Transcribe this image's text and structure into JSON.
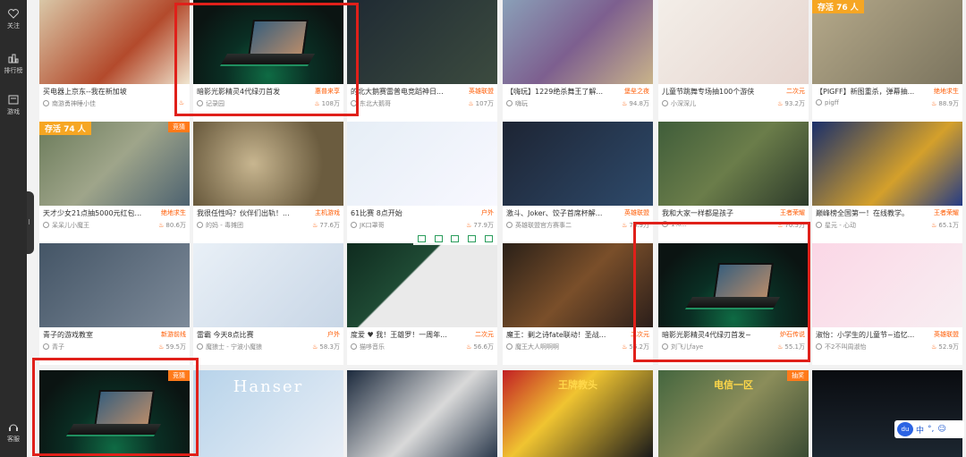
{
  "sidebar": {
    "items": [
      {
        "label": "关注",
        "icon": "heart-icon"
      },
      {
        "label": "排行榜",
        "icon": "bar-chart-icon"
      },
      {
        "label": "游戏",
        "icon": "gamepad-icon"
      },
      {
        "label": "客服",
        "icon": "headset-icon"
      }
    ]
  },
  "rows": [
    [
      {
        "title": "买电器上京东--我在新加坡",
        "category": "",
        "streamer": "南游勇神睡小佳",
        "viewers": "",
        "thumb": "food"
      },
      {
        "title": "暗影光影精灵4代绿刃首发",
        "category": "惠普来享",
        "streamer": "记录园",
        "viewers": "108万",
        "thumb": "laptop"
      },
      {
        "title": "的北大鹅赛雷普电竞蹈神日...",
        "category": "英雄联盟",
        "streamer": "东北大鹅哥",
        "viewers": "107万",
        "thumb": "dark"
      },
      {
        "title": "【嗨玩】1229绝杀舞王了解...",
        "category": "堡垒之夜",
        "streamer": "嗨玩",
        "viewers": "94.8万",
        "thumb": "game"
      },
      {
        "title": "儿童节跳舞专场抽100个游侠",
        "category": "二次元",
        "streamer": "小深深儿",
        "viewers": "93.2万",
        "thumb": "girl"
      },
      {
        "title": "【PIGFF】新图重杀，弹幕抽...",
        "category": "绝地求生",
        "streamer": "pigff",
        "viewers": "88.9万",
        "thumb": "pubg",
        "badge": "存活 76 人"
      }
    ],
    [
      {
        "title": "天才少女21点抽5000元红包...",
        "category": "绝地求生",
        "streamer": "呆呆儿小魔王",
        "viewers": "80.6万",
        "thumb": "map",
        "badge": "存活 74 人",
        "quiz": "竞猜"
      },
      {
        "title": "我很任性吗？伙伴们出轨！...",
        "category": "主机游戏",
        "streamer": "的妈 - 毒摊团",
        "viewers": "77.6万",
        "thumb": "coin"
      },
      {
        "title": "61比赛 8点开始",
        "category": "户外",
        "streamer": "JK口罩哥",
        "viewers": "77.9万",
        "thumb": "chat"
      },
      {
        "title": "激斗、Joker、饺子首席杯解...",
        "category": "英雄联盟",
        "streamer": "英雄联盟官方赛事二",
        "viewers": "76.9万",
        "thumb": "esports"
      },
      {
        "title": "我和大家一样都是孩子",
        "category": "王者荣耀",
        "streamer": "1%...",
        "viewers": "70.5万",
        "thumb": "moba"
      },
      {
        "title": "巅峰榜全国第一！在线教学。",
        "category": "王者荣耀",
        "streamer": "星元 - 心动",
        "viewers": "65.1万",
        "thumb": "banner"
      }
    ],
    [
      {
        "title": "青子的游戏教室",
        "category": "新游前线",
        "streamer": "青子",
        "viewers": "59.5万",
        "thumb": "anime"
      },
      {
        "title": "雷霸 今天8点比赛",
        "category": "户外",
        "streamer": "魔狼士 - 宁波小魔狼",
        "viewers": "58.3万",
        "thumb": "screen"
      },
      {
        "title": "度爱 ♥ 我！王雄罗！一周年...",
        "category": "二次元",
        "streamer": "猫哆音乐",
        "viewers": "56.6万",
        "thumb": "chat2"
      },
      {
        "title": "魔王：剿之诗fate联动！圣战...",
        "category": "二次元",
        "streamer": "魔王大人啊啊啊",
        "viewers": "56.2万",
        "thumb": "cards"
      },
      {
        "title": "暗影光影精灵4代绿刃首发~",
        "category": "炉石传说",
        "streamer": "刘飞儿faye",
        "viewers": "55.1万",
        "thumb": "laptop"
      },
      {
        "title": "淑怡：小学生的儿童节~追忆...",
        "category": "英雄联盟",
        "streamer": "不2不叫周淑怡",
        "viewers": "52.9万",
        "thumb": "pink"
      }
    ],
    [
      {
        "title": "",
        "category": "",
        "streamer": "",
        "viewers": "",
        "thumb": "laptop",
        "quiz": "竞猜"
      },
      {
        "title": "",
        "category": "",
        "streamer": "",
        "viewers": "",
        "thumb": "hanser",
        "overlay": "Hanser"
      },
      {
        "title": "",
        "category": "",
        "streamer": "",
        "viewers": "",
        "thumb": "room"
      },
      {
        "title": "",
        "category": "",
        "streamer": "",
        "viewers": "",
        "thumb": "king",
        "overlay": "王牌教头"
      },
      {
        "title": "",
        "category": "",
        "streamer": "",
        "viewers": "",
        "thumb": "moba2",
        "quiz": "抽奖",
        "overlay": "电信一区"
      },
      {
        "title": "",
        "category": "",
        "streamer": "",
        "viewers": "",
        "thumb": "night"
      }
    ]
  ],
  "ime": {
    "du": "du",
    "chars": [
      "中",
      "°,",
      "☺"
    ]
  },
  "colors": {
    "accent": "#ff5a00",
    "highlight": "#e0201a",
    "sidebar": "#2b2b2b"
  }
}
